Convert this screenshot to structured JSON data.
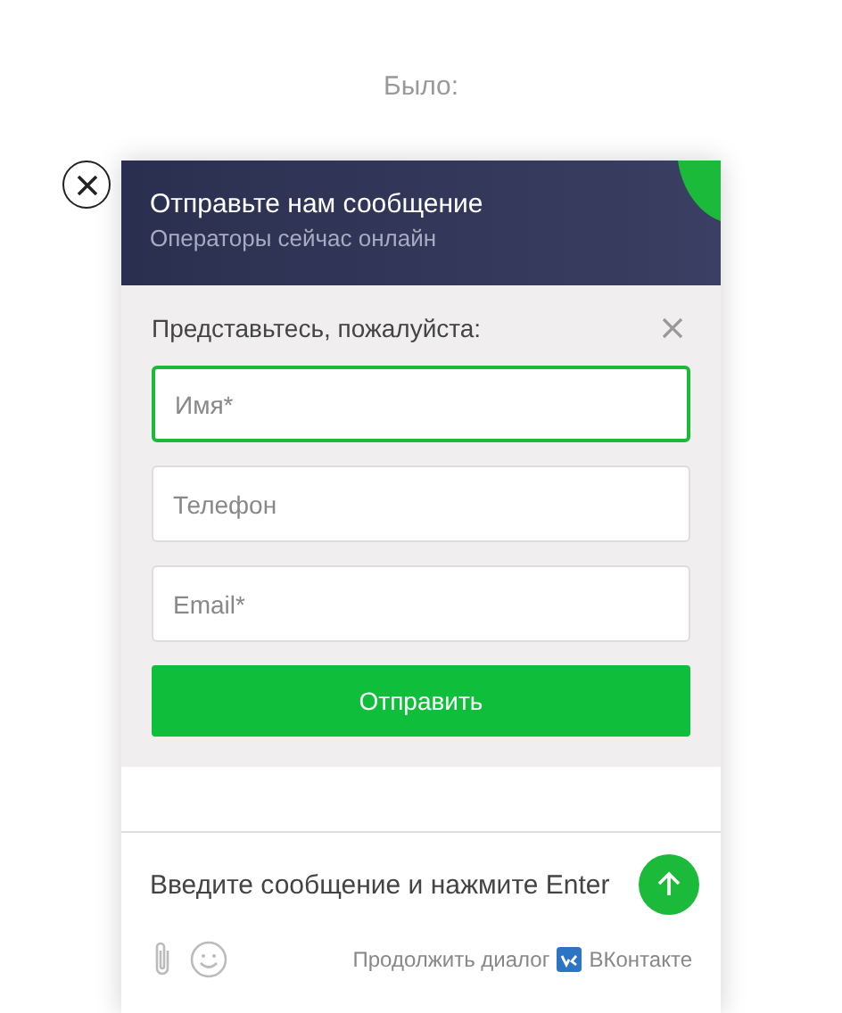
{
  "caption": "Было:",
  "header": {
    "title": "Отправьте нам сообщение",
    "subtitle": "Операторы сейчас онлайн"
  },
  "form": {
    "prompt": "Представьтесь, пожалуйста:",
    "fields": [
      {
        "placeholder": "Имя*",
        "focused": true
      },
      {
        "placeholder": "Телефон",
        "focused": false
      },
      {
        "placeholder": "Email*",
        "focused": false
      }
    ],
    "submit": "Отправить"
  },
  "composer": {
    "placeholder": "Введите сообщение и нажмите Enter"
  },
  "footer": {
    "continue_text": "Продолжить диалог",
    "network": "ВКонтакте"
  }
}
